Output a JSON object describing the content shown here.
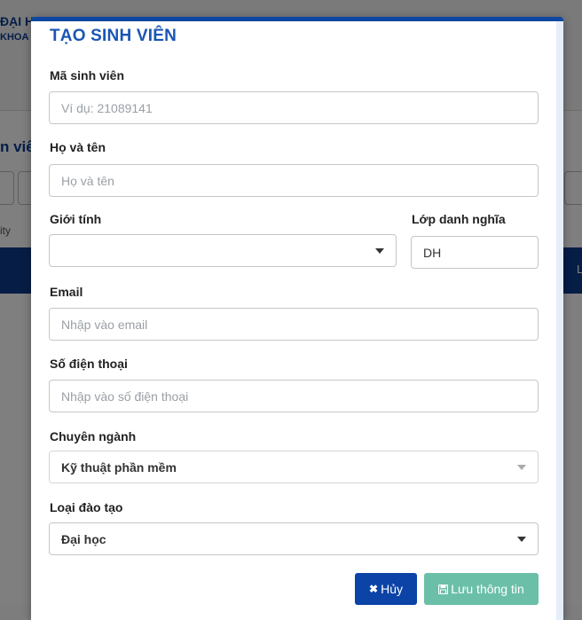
{
  "background": {
    "university_text": "ĐẠI HỌ",
    "faculty_text": "KHOA C",
    "page_title_fragment": "n viê",
    "city_fragment": "ity",
    "bar_fragment": "L"
  },
  "modal": {
    "title": "TẠO SINH VIÊN",
    "fields": {
      "student_id": {
        "label": "Mã sinh viên",
        "placeholder": "Ví dụ: 21089141",
        "value": ""
      },
      "full_name": {
        "label": "Họ và tên",
        "placeholder": "Họ và tên",
        "value": ""
      },
      "gender": {
        "label": "Giới tính",
        "selected": ""
      },
      "nominal_class": {
        "label": "Lớp danh nghĩa",
        "placeholder": "",
        "value": "DH"
      },
      "email": {
        "label": "Email",
        "placeholder": "Nhập vào email",
        "value": ""
      },
      "phone": {
        "label": "Số điện thoại",
        "placeholder": "Nhập vào số điện thoại",
        "value": ""
      },
      "major": {
        "label": "Chuyên ngành",
        "selected": "Kỹ thuật phần mềm"
      },
      "training_type": {
        "label": "Loại đào tạo",
        "selected": "Đại học"
      }
    },
    "buttons": {
      "cancel": "Hủy",
      "save": "Lưu thông tin"
    }
  },
  "colors": {
    "accent": "#0d47a1",
    "title": "#1a56b6",
    "cancel_button": "#0b43a7",
    "save_button": "#6bbfa8"
  },
  "icons": {
    "cancel": "close-icon",
    "save": "save-icon",
    "dropdown": "caret-down-icon"
  }
}
